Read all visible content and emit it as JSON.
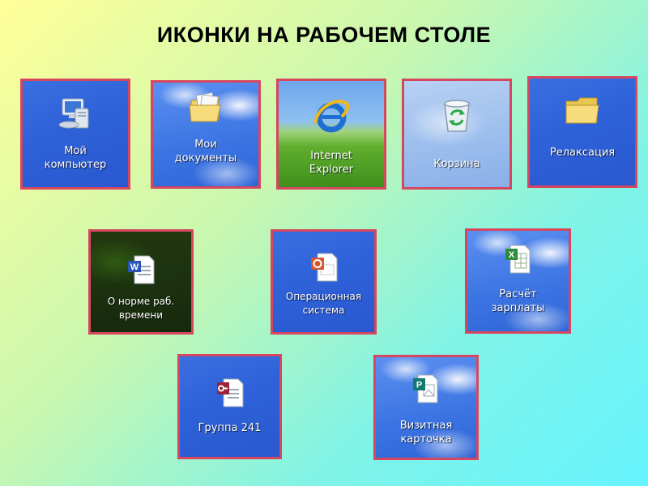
{
  "title": "ИКОНКИ НА РАБОЧЕМ СТОЛЕ",
  "icons": [
    {
      "name": "computer-icon",
      "lines": [
        "Мой",
        "компьютер"
      ]
    },
    {
      "name": "documents-folder-icon",
      "lines": [
        "Мои",
        "документы"
      ]
    },
    {
      "name": "internet-explorer-icon",
      "lines": [
        "Internet",
        "Explorer"
      ]
    },
    {
      "name": "recycle-bin-icon",
      "lines": [
        "Корзина"
      ]
    },
    {
      "name": "folder-icon",
      "lines": [
        "Релаксация"
      ]
    },
    {
      "name": "word-document-icon",
      "lines": [
        "О норме раб.",
        "времени"
      ]
    },
    {
      "name": "powerpoint-document-icon",
      "lines": [
        "Операционная",
        "система"
      ]
    },
    {
      "name": "excel-document-icon",
      "lines": [
        "Расчёт",
        "зарплаты"
      ]
    },
    {
      "name": "access-document-icon",
      "lines": [
        "Группа 241"
      ]
    },
    {
      "name": "publisher-document-icon",
      "lines": [
        "Визитная",
        "карточка"
      ]
    }
  ],
  "colors": {
    "tile_border": "#d6475f",
    "label_text": "#ffffff"
  }
}
